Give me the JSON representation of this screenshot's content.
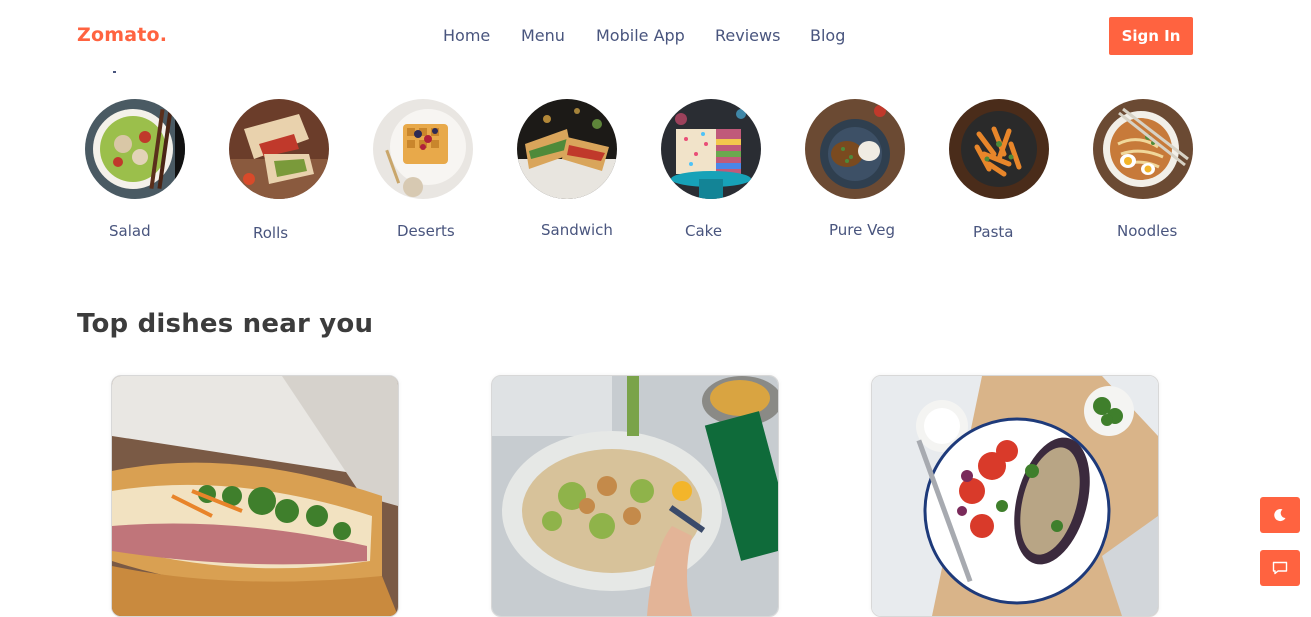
{
  "navbar": {
    "logo": "Zomato.",
    "links": [
      "Home",
      "Menu",
      "Mobile App",
      "Reviews",
      "Blog"
    ],
    "signin_label": "Sign In"
  },
  "categories": [
    {
      "label": "Salad",
      "icon": "salad-image"
    },
    {
      "label": "Rolls",
      "icon": "rolls-image"
    },
    {
      "label": "Deserts",
      "icon": "deserts-image"
    },
    {
      "label": "Sandwich",
      "icon": "sandwich-image"
    },
    {
      "label": "Cake",
      "icon": "cake-image"
    },
    {
      "label": "Pure Veg",
      "icon": "pure-veg-image"
    },
    {
      "label": "Pasta",
      "icon": "pasta-image"
    },
    {
      "label": "Noodles",
      "icon": "noodles-image"
    }
  ],
  "top_dishes": {
    "title": "Top dishes near you",
    "items": [
      {
        "image": "banh-mi-sandwich-image"
      },
      {
        "image": "salad-bowl-image"
      },
      {
        "image": "eggplant-salad-plate-image"
      }
    ]
  },
  "floating": {
    "theme_icon": "moon-icon",
    "chat_icon": "chat-icon"
  },
  "colors": {
    "accent": "#ff6340",
    "text": "#49557e",
    "heading": "#3c3c3c"
  }
}
